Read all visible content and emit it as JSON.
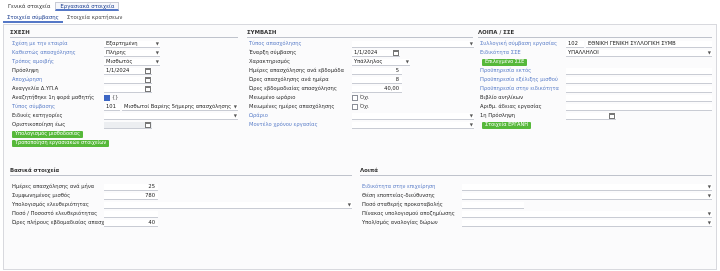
{
  "top_tabs": [
    {
      "label": "Γενικά στοιχεία",
      "active": false
    },
    {
      "label": "Εργασιακά στοιχεία",
      "active": true
    }
  ],
  "sub_tabs": [
    {
      "label": "Στοιχεία σύμβασης",
      "active": true
    },
    {
      "label": "Στοιχεία κρατήσεων",
      "active": false
    }
  ],
  "sxesi": {
    "title": "ΣΧΕΣΗ",
    "sxesi_label": "Σχέση με την εταιρία",
    "sxesi_value": "Εξαρτημένη",
    "kathestos_label": "Καθεστώς απασχόλησης",
    "kathestos_value": "Πλήρης",
    "tropos_label": "Τρόπος αμοιβής",
    "tropos_value": "Μισθωτός",
    "proslipsi_label": "Πρόσληψη",
    "proslipsi_value": "1/1/2024",
    "apoxorisi_label": "Αποχώρηση",
    "anaggelia_label": "Αναγγελία Δ.ΥΠ.Α",
    "anaziti_label": "Αναζητήθηκε 1η φορά μαθητής",
    "anaziti_value": "{}",
    "typos_label": "Τύπος σύμβασης",
    "typos_code": "101",
    "typos_value": "Μισθωτοί Βαρέης 5ήμερης απασχόλησης",
    "eidikes_label": "Ειδικές κατηγορίες",
    "oristikopoiisi_label": "Οριστικοποίηση έως",
    "btn_ypologismos": "Υπολογισμός μισθοδοσίας",
    "btn_tropopoiisi": "Τροποποίηση εργασιακών στοιχείων"
  },
  "symvasi": {
    "title": "ΣΥΜΒΑΣΗ",
    "typos_apasx_label": "Τύπος απασχόλησης",
    "enarxi_label": "Έναρξη σύμβασης",
    "enarxi_value": "1/1/2024",
    "xarakt_label": "Χαρακτηρισμός",
    "xarakt_value": "Υπάλληλος",
    "imeres_label": "Ημέρες απασχόλησης ανά εβδομάδα",
    "imeres_value": "5",
    "ores_imera_label": "Ώρες απασχόλησης ανά ημέρα",
    "ores_imera_value": "8",
    "ores_evd_label": "Ώρες εβδομαδιαίας απασχόλησης",
    "ores_evd_value": "40,00",
    "meiomeno_label": "Μειωμένο ωράριο",
    "meiomeno_chk": "Όχι",
    "meiomenes_label": "Μειωμένες ημέρες απασχόλησης",
    "meiomenes_chk": "Όχι",
    "orario_label": "Ωράριο",
    "montelo_label": "Μοντέλο χρόνου εργασίας"
  },
  "loipa": {
    "title": "ΛΟΙΠΑ / ΣΣΕ",
    "syllogiki_label": "Συλλογική σύμβαση εργασίας",
    "syllogiki_code": "102",
    "syllogiki_value": "ΕΘΝΙΚΗ ΓΕΝΙΚΗ ΣΥΛΛΟΓΙΚΗ ΣΥΜΒ",
    "eidikotita_label": "Ειδικότητα ΣΣΕ",
    "eidikotita_value": "ΥΠΑΛΛΗΛΟΙ",
    "btn_epilegmeno": "Επιλεγμένο ΣΣΕ",
    "proypiresia_ektos_label": "Προϋπηρεσία εκτός",
    "proypiresia_misthou_label": "Προϋπηρεσία εξέλιξης μισθού",
    "proypiresia_eidikotita_label": "Προϋπηρεσία στην ειδικότητα",
    "vivlio_label": "Βιβλίο ανηλίκων",
    "arithmos_label": "Αριθμ. άδειας εργασίας",
    "proslipsi1_label": "1η Πρόσληψη",
    "btn_ergani": "Στοιχεία ΕΡΓΑΝΗ"
  },
  "vasika": {
    "title": "Βασικά στοιχεία",
    "imeres_mina_label": "Ημέρες απασχόλησης ανά μήνα",
    "imeres_mina_value": "25",
    "symfonimenos_label": "Συμφωνημένος μισθός",
    "symfonimenos_value": "780",
    "ypologismos_label": "Υπολογισμός ελευθεριότητας",
    "poso_label": "Ποσό / Ποσοστό ελευθεριότητας",
    "ores_plirous_label": "Ώρες πλήρους εβδομαδιαίας απασχ",
    "ores_plirous_value": "40"
  },
  "loipa2": {
    "title": "Λοιπά",
    "eidikotita_label": "Ειδικότητα στην επιχείρηση",
    "thesi_label": "Θέση εποπτείας-διεύθυνσης",
    "poso_label": "Ποσό σταθερής προκαταβολής",
    "pinakas_label": "Πίνακας υπολογισμού αποζημίωσης",
    "ypologismos_label": "Υπολ/σμός αναλογίας δώρων"
  }
}
